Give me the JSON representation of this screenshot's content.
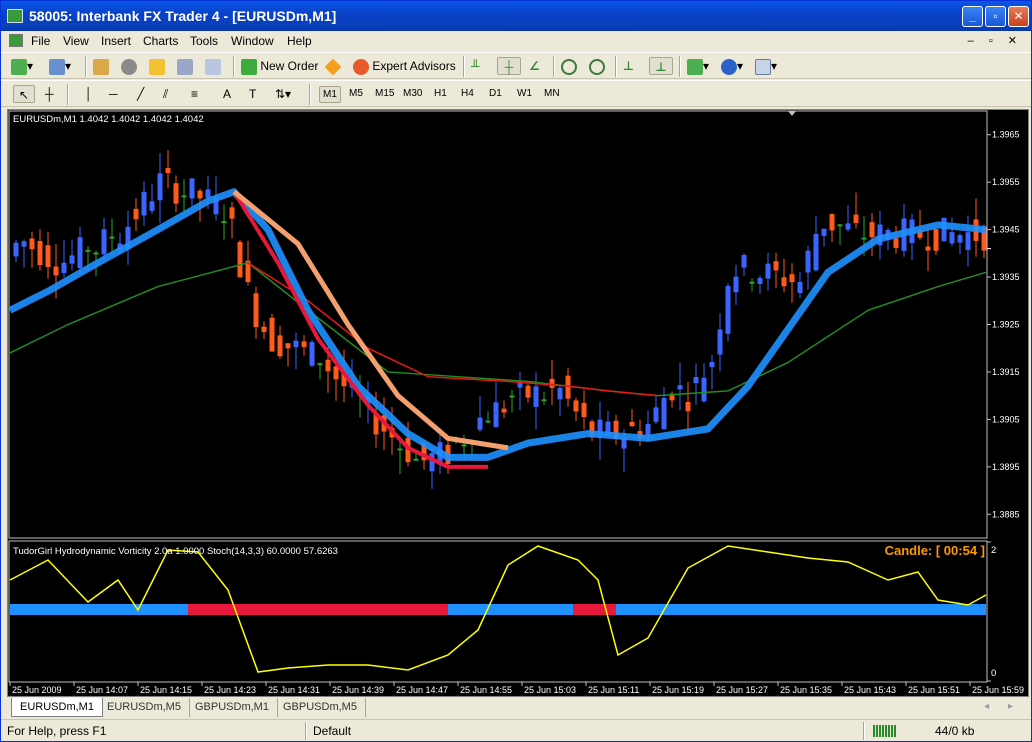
{
  "window": {
    "title": "58005: Interbank FX Trader 4 - [EURUSDm,M1]"
  },
  "menu": [
    "File",
    "View",
    "Insert",
    "Charts",
    "Tools",
    "Window",
    "Help"
  ],
  "toolbar": {
    "new_order": "New Order",
    "expert_advisors": "Expert Advisors"
  },
  "timeframes": [
    "M1",
    "M5",
    "M15",
    "M30",
    "H1",
    "H4",
    "D1",
    "W1",
    "MN"
  ],
  "active_timeframe": "M1",
  "chart": {
    "header": "EURUSDm,M1  1.4042 1.4042 1.4042 1.4042",
    "price_labels": [
      "1.3965",
      "1.3955",
      "1.3945",
      "1.3935",
      "1.3925",
      "1.3915",
      "1.3905",
      "1.3895",
      "1.3885"
    ],
    "current_price": "1.3941",
    "indicator_header": "TudorGirl Hydrodynamic Vorticity 2.0a 1.0000  Stoch(14,3,3) 60.0000 57.6263",
    "candle_timer": "Candle: [ 00:54 ]",
    "indicator_scale_top": "2",
    "indicator_scale_bottom": "0",
    "time_labels": [
      "25 Jun 2009",
      "25 Jun 14:07",
      "25 Jun 14:15",
      "25 Jun 14:23",
      "25 Jun 14:31",
      "25 Jun 14:39",
      "25 Jun 14:47",
      "25 Jun 14:55",
      "25 Jun 15:03",
      "25 Jun 15:11",
      "25 Jun 15:19",
      "25 Jun 15:27",
      "25 Jun 15:35",
      "25 Jun 15:43",
      "25 Jun 15:51",
      "25 Jun 15:59"
    ],
    "colors": {
      "bull": "#3a66ff",
      "bear": "#ff5a1e",
      "doji": "#2ea52e",
      "ma_fast": "#1e90ff",
      "ma_alt": "#e8173c",
      "ma_slow": "#228b22",
      "ma_mid": "#e81818",
      "ma_peach": "#f4a06e",
      "stoch": "#ffff00",
      "candle_timer": "#ff9900"
    }
  },
  "tabs": [
    "EURUSDm,M1",
    "EURUSDm,M5",
    "GBPUSDm,M1",
    "GBPUSDm,M5"
  ],
  "status": {
    "help": "For Help, press F1",
    "profile": "Default",
    "traffic": "44/0 kb"
  }
}
